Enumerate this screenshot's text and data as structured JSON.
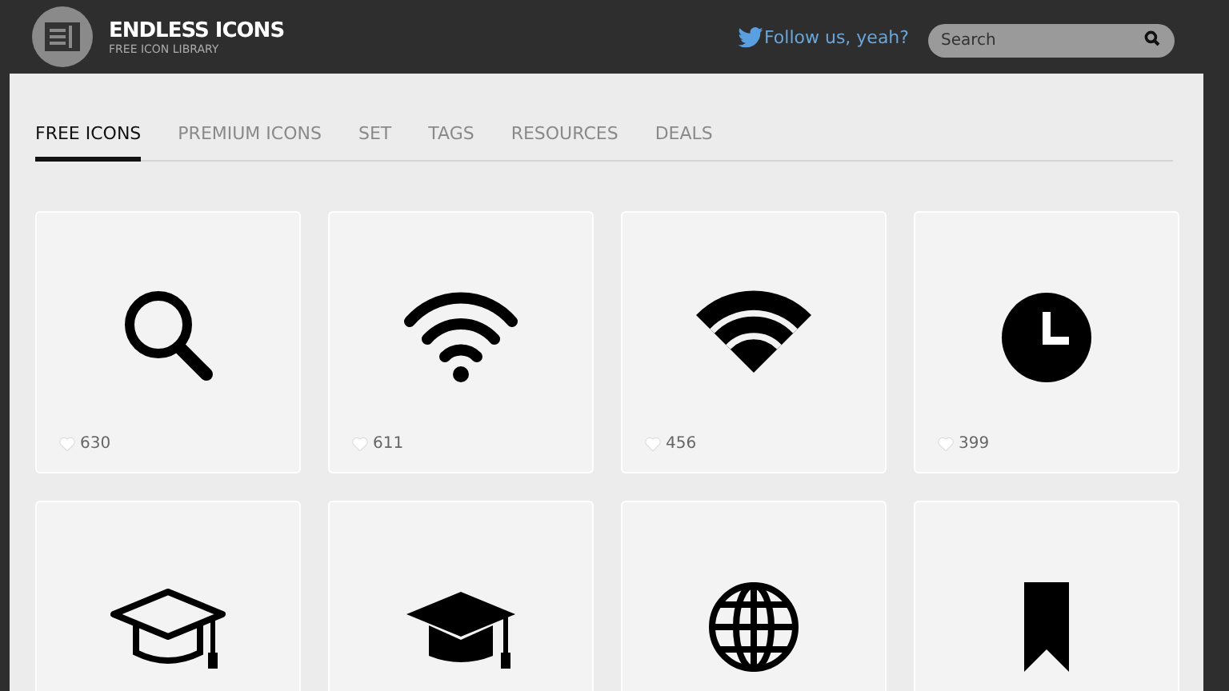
{
  "header": {
    "title": "ENDLESS ICONS",
    "subtitle": "FREE ICON LIBRARY",
    "follow_link": "Follow us, yeah?",
    "search": {
      "placeholder": "Search"
    }
  },
  "tabs": [
    {
      "label": "FREE ICONS",
      "selected": true
    },
    {
      "label": "PREMIUM ICONS",
      "selected": false
    },
    {
      "label": "SET",
      "selected": false
    },
    {
      "label": "TAGS",
      "selected": false
    },
    {
      "label": "RESOURCES",
      "selected": false
    },
    {
      "label": "DEALS",
      "selected": false
    }
  ],
  "cards": [
    {
      "kind": "search",
      "likes": "630"
    },
    {
      "kind": "wifi",
      "likes": "611"
    },
    {
      "kind": "wifi-solid",
      "likes": "456"
    },
    {
      "kind": "clock",
      "likes": "399"
    },
    {
      "kind": "cap-outline"
    },
    {
      "kind": "cap"
    },
    {
      "kind": "globe"
    },
    {
      "kind": "bookmark"
    }
  ]
}
